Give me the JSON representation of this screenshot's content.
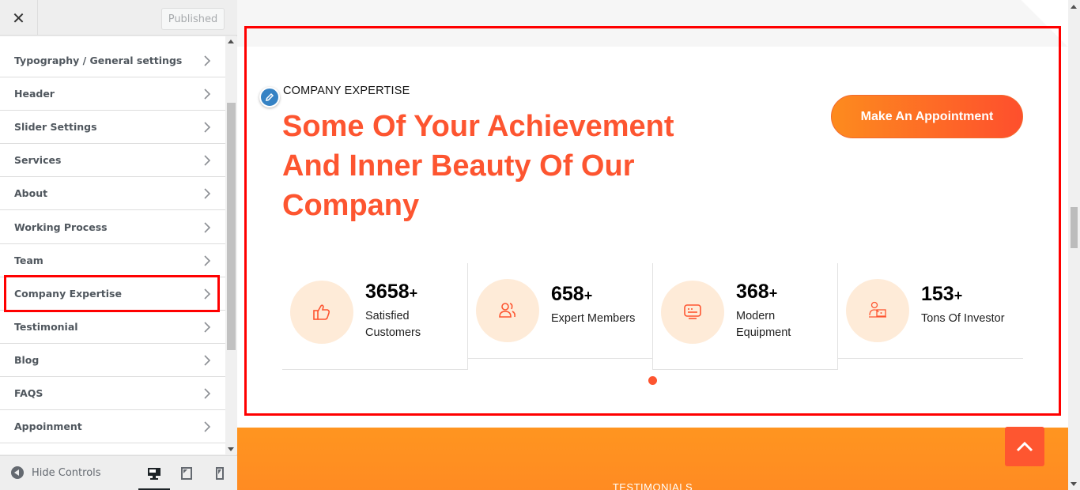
{
  "sidebar": {
    "close_label": "✕",
    "publish_label": "Published",
    "items": [
      {
        "label": "Typography / General settings"
      },
      {
        "label": "Header"
      },
      {
        "label": "Slider Settings"
      },
      {
        "label": "Services"
      },
      {
        "label": "About"
      },
      {
        "label": "Working Process"
      },
      {
        "label": "Team"
      },
      {
        "label": "Company Expertise",
        "highlighted": true
      },
      {
        "label": "Testimonial"
      },
      {
        "label": "Blog"
      },
      {
        "label": "FAQS"
      },
      {
        "label": "Appoinment"
      }
    ],
    "footer": {
      "hide_controls_label": "Hide Controls",
      "devices": [
        {
          "name": "desktop",
          "active": true
        },
        {
          "name": "tablet",
          "active": false
        },
        {
          "name": "mobile",
          "active": false
        }
      ]
    }
  },
  "preview": {
    "section": {
      "eyebrow": "COMPANY EXPERTISE",
      "headline": "Some Of Your Achievement And Inner Beauty Of Our Company",
      "cta_label": "Make An Appointment",
      "stats": [
        {
          "number": "3658",
          "suffix": "+",
          "label_line1": "Satisfied",
          "label_line2": "Customers",
          "icon": "thumbs-up-icon"
        },
        {
          "number": "658",
          "suffix": "+",
          "label_line1": "Expert Members",
          "label_line2": "",
          "icon": "users-icon"
        },
        {
          "number": "368",
          "suffix": "+",
          "label_line1": "Modern",
          "label_line2": "Equipment",
          "icon": "monitor-icon"
        },
        {
          "number": "153",
          "suffix": "+",
          "label_line1": "Tons Of Investor",
          "label_line2": "",
          "icon": "investor-icon"
        }
      ],
      "carousel_pages": 1,
      "carousel_active": 1
    },
    "next_section_title": "TESTIMONIALS",
    "colors": {
      "accent": "#fd5530",
      "icon_bg": "#feebd8",
      "band_orange": "#ff9520",
      "highlight": "#ff0000"
    }
  }
}
